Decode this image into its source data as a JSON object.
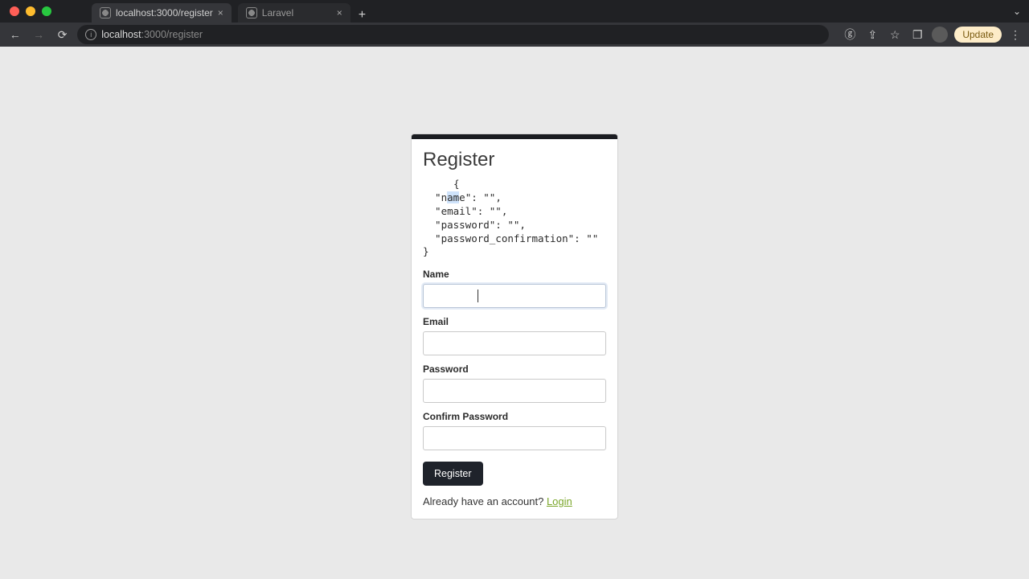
{
  "browser": {
    "tabs": [
      {
        "title": "localhost:3000/register",
        "active": true
      },
      {
        "title": "Laravel",
        "active": false
      }
    ],
    "address": {
      "host": "localhost",
      "port_path": ":3000/register"
    },
    "update_label": "Update"
  },
  "card": {
    "title": "Register",
    "debug": {
      "line0": "{",
      "line1_pre": "  \"n",
      "line1_hi": "am",
      "line1_post": "e\": \"\",",
      "line2": "  \"email\": \"\",",
      "line3": "  \"password\": \"\",",
      "line4": "  \"password_confirmation\": \"\"",
      "line5": "}"
    },
    "fields": {
      "name_label": "Name",
      "email_label": "Email",
      "password_label": "Password",
      "confirm_label": "Confirm Password"
    },
    "submit_label": "Register",
    "already_text": "Already have an account? ",
    "login_text": "Login"
  },
  "form_values": {
    "name": "",
    "email": "",
    "password": "",
    "password_confirmation": ""
  }
}
